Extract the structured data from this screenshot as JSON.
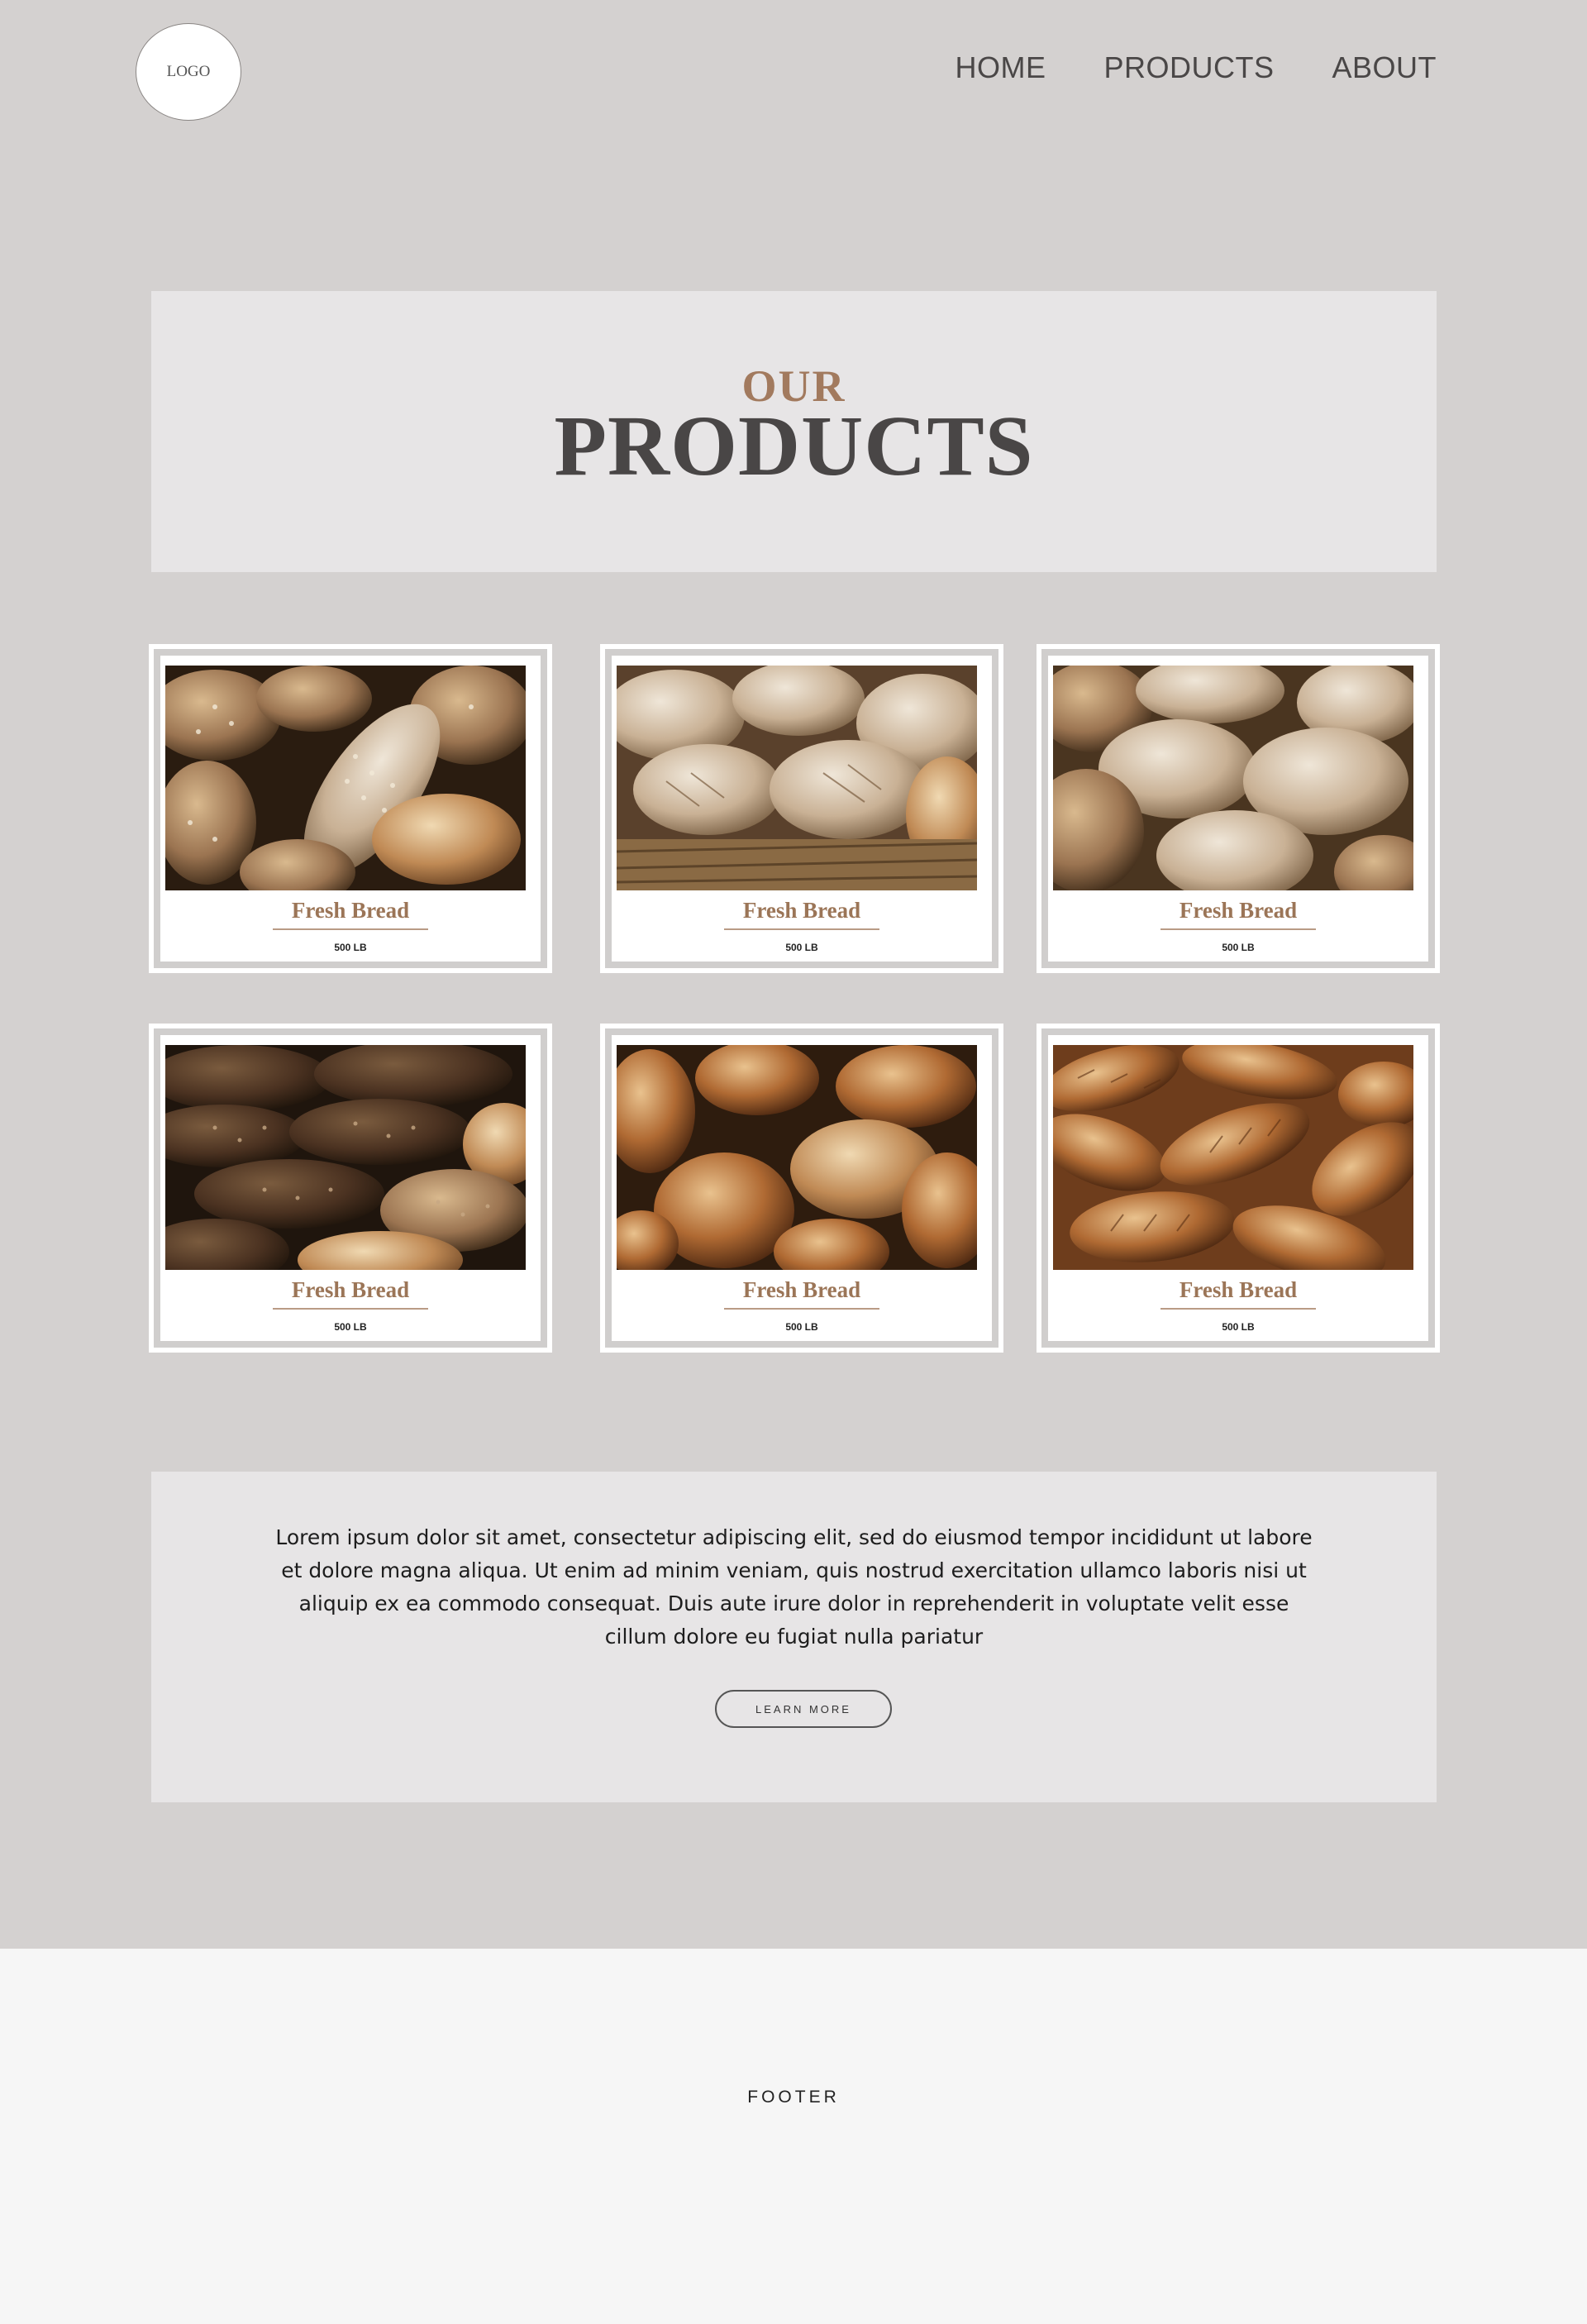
{
  "header": {
    "logo_text": "LOGO",
    "nav": [
      "HOME",
      "PRODUCTS",
      "ABOUT"
    ]
  },
  "hero": {
    "kicker": "OUR",
    "title": "PRODUCTS"
  },
  "products": [
    {
      "name": "Fresh Bread",
      "weight": "500 LB",
      "image": "seeded-bread-rolls"
    },
    {
      "name": "Fresh Bread",
      "weight": "500 LB",
      "image": "rustic-loaves-basket"
    },
    {
      "name": "Fresh Bread",
      "weight": "500 LB",
      "image": "multigrain-buns"
    },
    {
      "name": "Fresh Bread",
      "weight": "500 LB",
      "image": "dark-seeded-rolls"
    },
    {
      "name": "Fresh Bread",
      "weight": "500 LB",
      "image": "crusty-rolls"
    },
    {
      "name": "Fresh Bread",
      "weight": "500 LB",
      "image": "croissants"
    }
  ],
  "info": {
    "text": "Lorem ipsum dolor sit amet, consectetur adipiscing elit, sed do eiusmod tempor incididunt ut labore et dolore magna aliqua. Ut enim ad minim veniam, quis nostrud exercitation ullamco laboris nisi ut aliquip ex ea commodo consequat. Duis aute irure dolor in reprehenderit in voluptate velit esse cillum dolore eu fugiat nulla pariatur",
    "button_label": "LEARN MORE"
  },
  "footer": {
    "label": "FOOTER"
  },
  "colors": {
    "page_bg": "#d4d1d0",
    "panel_bg": "#e7e5e6",
    "accent": "#a27a5e",
    "heading": "#494646",
    "footer_bg": "#f6f6f6"
  }
}
